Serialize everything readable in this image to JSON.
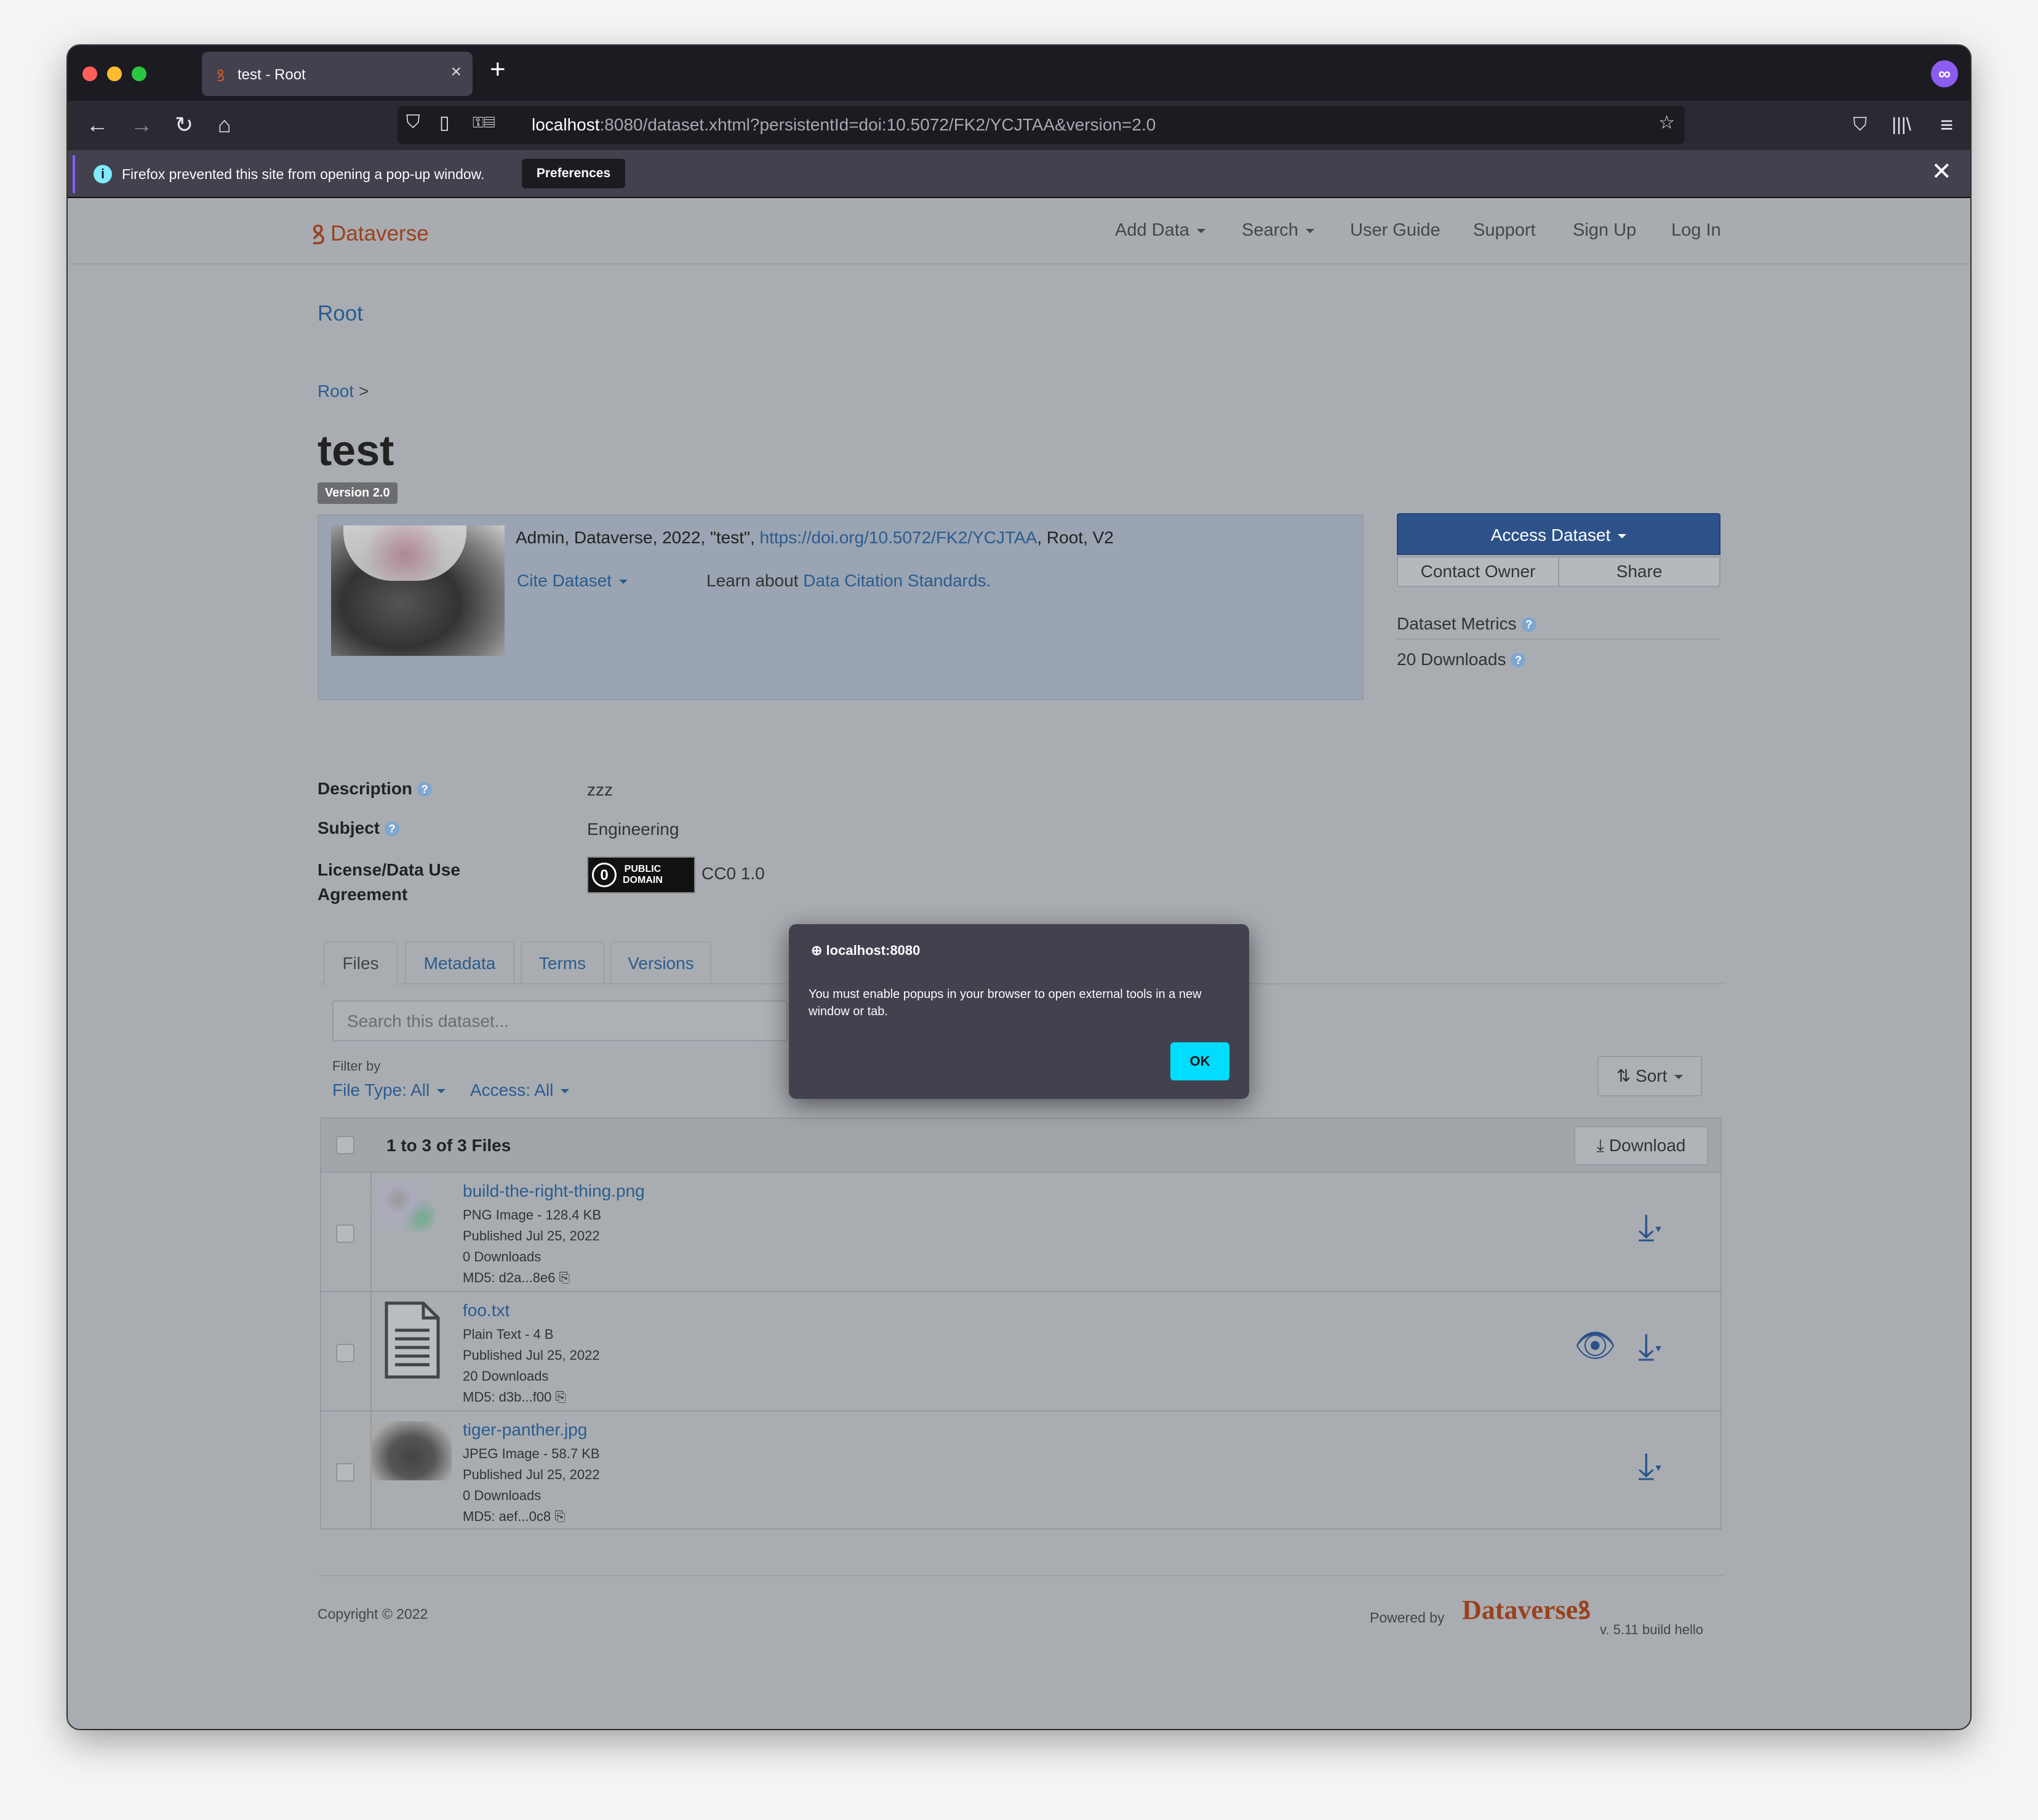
{
  "browser": {
    "tab_title": "test - Root",
    "url_host": "localhost",
    "url_rest": ":8080/dataset.xhtml?persistentId=doi:10.5072/FK2/YCJTAA&version=2.0",
    "notification": "Firefox prevented this site from opening a pop-up window.",
    "notification_button": "Preferences"
  },
  "header": {
    "logo": "Dataverse",
    "menu": [
      "Add Data",
      "Search",
      "User Guide",
      "Support",
      "Sign Up",
      "Log In"
    ]
  },
  "dataverse_title": "Root",
  "breadcrumb": {
    "root": "Root",
    "sep": ">"
  },
  "dataset": {
    "title": "test",
    "version": "Version 2.0",
    "citation_prefix": "Admin, Dataverse, 2022, \"test\", ",
    "citation_doi": "https://doi.org/10.5072/FK2/YCJTAA",
    "citation_suffix": ", Root, V2",
    "cite_button": "Cite Dataset",
    "learn_prefix": "Learn about ",
    "learn_link": "Data Citation Standards."
  },
  "sidebar": {
    "access": "Access Dataset",
    "contact": "Contact Owner",
    "share": "Share",
    "metrics": "Dataset Metrics",
    "downloads": "20 Downloads"
  },
  "metadata": {
    "description_label": "Description",
    "description_value": "zzz",
    "subject_label": "Subject",
    "subject_value": "Engineering",
    "license_label_1": "License/Data Use",
    "license_label_2": "Agreement",
    "license_badge_1": "PUBLIC",
    "license_badge_2": "DOMAIN",
    "license_value": "CC0 1.0"
  },
  "tabs": [
    "Files",
    "Metadata",
    "Terms",
    "Versions"
  ],
  "files_panel": {
    "search_placeholder": "Search this dataset...",
    "filter_label": "Filter by",
    "filter_type": "File Type: All",
    "filter_access": "Access: All",
    "sort": "Sort",
    "count": "1 to 3 of 3 Files",
    "download": "Download"
  },
  "files": [
    {
      "name": "build-the-right-thing.png",
      "type": "PNG Image - 128.4 KB",
      "published": "Published Jul 25, 2022",
      "downloads": "0 Downloads",
      "md5": "MD5: d2a...8e6"
    },
    {
      "name": "foo.txt",
      "type": "Plain Text - 4 B",
      "published": "Published Jul 25, 2022",
      "downloads": "20 Downloads",
      "md5": "MD5: d3b...f00"
    },
    {
      "name": "tiger-panther.jpg",
      "type": "JPEG Image - 58.7 KB",
      "published": "Published Jul 25, 2022",
      "downloads": "0 Downloads",
      "md5": "MD5: aef...0c8"
    }
  ],
  "footer": {
    "copyright": "Copyright © 2022",
    "powered": "Powered by",
    "logo": "Dataverse",
    "version": "v. 5.11 build hello"
  },
  "modal": {
    "host": "localhost:8080",
    "message": "You must enable popups in your browser to open external tools in a new window or tab.",
    "ok": "OK"
  }
}
